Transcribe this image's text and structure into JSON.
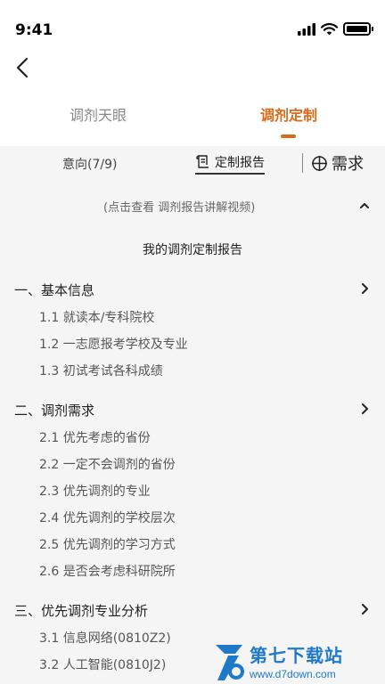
{
  "status_bar": {
    "time": "9:41"
  },
  "tabs": [
    {
      "label": "调剂天眼",
      "active": false
    },
    {
      "label": "调剂定制",
      "active": true
    }
  ],
  "sub_nav": {
    "intent": "意向(7/9)",
    "report": "定制报告",
    "need": "需求"
  },
  "hint": "(点击查看 调剂报告讲解视频)",
  "report_title": "我的调剂定制报告",
  "sections": [
    {
      "title": "一、基本信息",
      "items": [
        "1.1 就读本/专科院校",
        "1.2 一志愿报考学校及专业",
        "1.3 初试考试各科成绩"
      ]
    },
    {
      "title": "二、调剂需求",
      "items": [
        "2.1 优先考虑的省份",
        "2.2 一定不会调剂的省份",
        "2.3 优先调剂的专业",
        "2.4 优先调剂的学校层次",
        "2.5 优先调剂的学习方式",
        "2.6 是否会考虑科研院所"
      ]
    },
    {
      "title": "三、优先调剂专业分析",
      "items": [
        "3.1 信息网络(0810Z2)",
        "3.2 人工智能(0810J2)"
      ]
    }
  ],
  "watermark": {
    "title": "第七下载站",
    "url": "www.d7down.com"
  },
  "colors": {
    "accent": "#d96b1a",
    "background": "#f5f5f5",
    "watermark": "#1f79c7"
  }
}
